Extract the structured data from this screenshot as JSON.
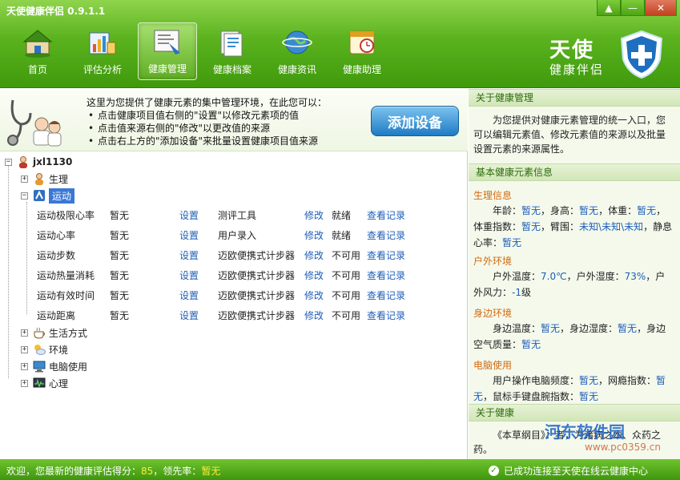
{
  "app": {
    "title": "天使健康伴侣 0.9.1.1"
  },
  "window_controls": {
    "menu": "▲",
    "minimize": "—",
    "close": "✕"
  },
  "nav": [
    {
      "label": "首页",
      "icon": "home-icon"
    },
    {
      "label": "评估分析",
      "icon": "analysis-icon"
    },
    {
      "label": "健康管理",
      "icon": "management-icon",
      "active": true
    },
    {
      "label": "健康档案",
      "icon": "archive-icon"
    },
    {
      "label": "健康资讯",
      "icon": "news-icon"
    },
    {
      "label": "健康助理",
      "icon": "assistant-icon"
    }
  ],
  "brand": {
    "line1": "天使",
    "line2": "健康伴侣"
  },
  "intro": {
    "heading": "这里为您提供了健康元素的集中管理环境，在此您可以：",
    "bullets": [
      "点击健康项目值右侧的\"设置\"以修改元素项的值",
      "点击值来源右侧的\"修改\"以更改值的来源",
      "点击右上方的\"添加设备\"来批量设置健康项目值来源"
    ],
    "add_device_label": "添加设备"
  },
  "tree": {
    "user": "jxl1130",
    "groups": [
      {
        "label": "生理",
        "expanded": false,
        "icon": "physiology-icon"
      },
      {
        "label": "运动",
        "expanded": true,
        "icon": "exercise-icon"
      },
      {
        "label": "生活方式",
        "expanded": false,
        "icon": "lifestyle-icon"
      },
      {
        "label": "环境",
        "expanded": false,
        "icon": "environment-icon"
      },
      {
        "label": "电脑使用",
        "expanded": false,
        "icon": "computer-icon"
      },
      {
        "label": "心理",
        "expanded": false,
        "icon": "psychology-icon"
      }
    ],
    "rows": [
      {
        "name": "运动极限心率",
        "value": "暂无",
        "set": "设置",
        "source": "测评工具",
        "modify": "修改",
        "status": "就绪",
        "view": "查看记录"
      },
      {
        "name": "运动心率",
        "value": "暂无",
        "set": "设置",
        "source": "用户录入",
        "modify": "修改",
        "status": "就绪",
        "view": "查看记录"
      },
      {
        "name": "运动步数",
        "value": "暂无",
        "set": "设置",
        "source": "迈欧便携式计步器",
        "modify": "修改",
        "status": "不可用",
        "view": "查看记录"
      },
      {
        "name": "运动热量消耗",
        "value": "暂无",
        "set": "设置",
        "source": "迈欧便携式计步器",
        "modify": "修改",
        "status": "不可用",
        "view": "查看记录"
      },
      {
        "name": "运动有效时间",
        "value": "暂无",
        "set": "设置",
        "source": "迈欧便携式计步器",
        "modify": "修改",
        "status": "不可用",
        "view": "查看记录"
      },
      {
        "name": "运动距离",
        "value": "暂无",
        "set": "设置",
        "source": "迈欧便携式计步器",
        "modify": "修改",
        "status": "不可用",
        "view": "查看记录"
      }
    ]
  },
  "right": {
    "about_mgmt": {
      "title": "关于健康管理",
      "text": "为您提供对健康元素管理的统一入口，您可以编辑元素值、修改元素值的来源以及批量设置元素的来源属性。"
    },
    "basic": {
      "title": "基本健康元素信息",
      "physio": {
        "title": "生理信息",
        "age_label": "年龄：",
        "age": "暂无",
        "height_label": "，身高：",
        "height": "暂无",
        "weight_label": "，体重：",
        "weight": "暂无",
        "bmi_label": "，体重指数：",
        "bmi": "暂无",
        "arm_label": "，臂围：",
        "arm": "未知\\未知\\未知",
        "rhr_label": "，静息心率：",
        "rhr": "暂无"
      },
      "outdoor": {
        "title": "户外环境",
        "temp_label": "户外温度：",
        "temp": "7.0℃",
        "hum_label": "，户外湿度：",
        "hum": "73%",
        "wind_label": "，户外风力：",
        "wind": "-1",
        "wind_unit": "级"
      },
      "nearby": {
        "title": "身边环境",
        "temp_label": "身边温度：",
        "temp": "暂无",
        "hum_label": "，身边湿度：",
        "hum": "暂无",
        "air_label": "，身边空气质量：",
        "air": "暂无"
      },
      "pc": {
        "title": "电脑使用",
        "freq_label": "用户操作电脑频度：",
        "freq": "暂无",
        "addict_label": "，网瘾指数：",
        "addict": "暂无",
        "kbm_label": "，鼠标手键盘腕指数：",
        "kbm": "暂无"
      }
    },
    "about_health": {
      "title": "关于健康",
      "text": "《本草纲目》：者，为诸病之本、众药之药。"
    }
  },
  "watermark": {
    "line1": "河东软件园",
    "line2": "www.pc0359.cn"
  },
  "status": {
    "prefix": "欢迎，您最新的健康评估得分：",
    "score": "85",
    "mid": "，领先率：",
    "lead": "暂无",
    "connected": "已成功连接至天使在线云健康中心"
  }
}
